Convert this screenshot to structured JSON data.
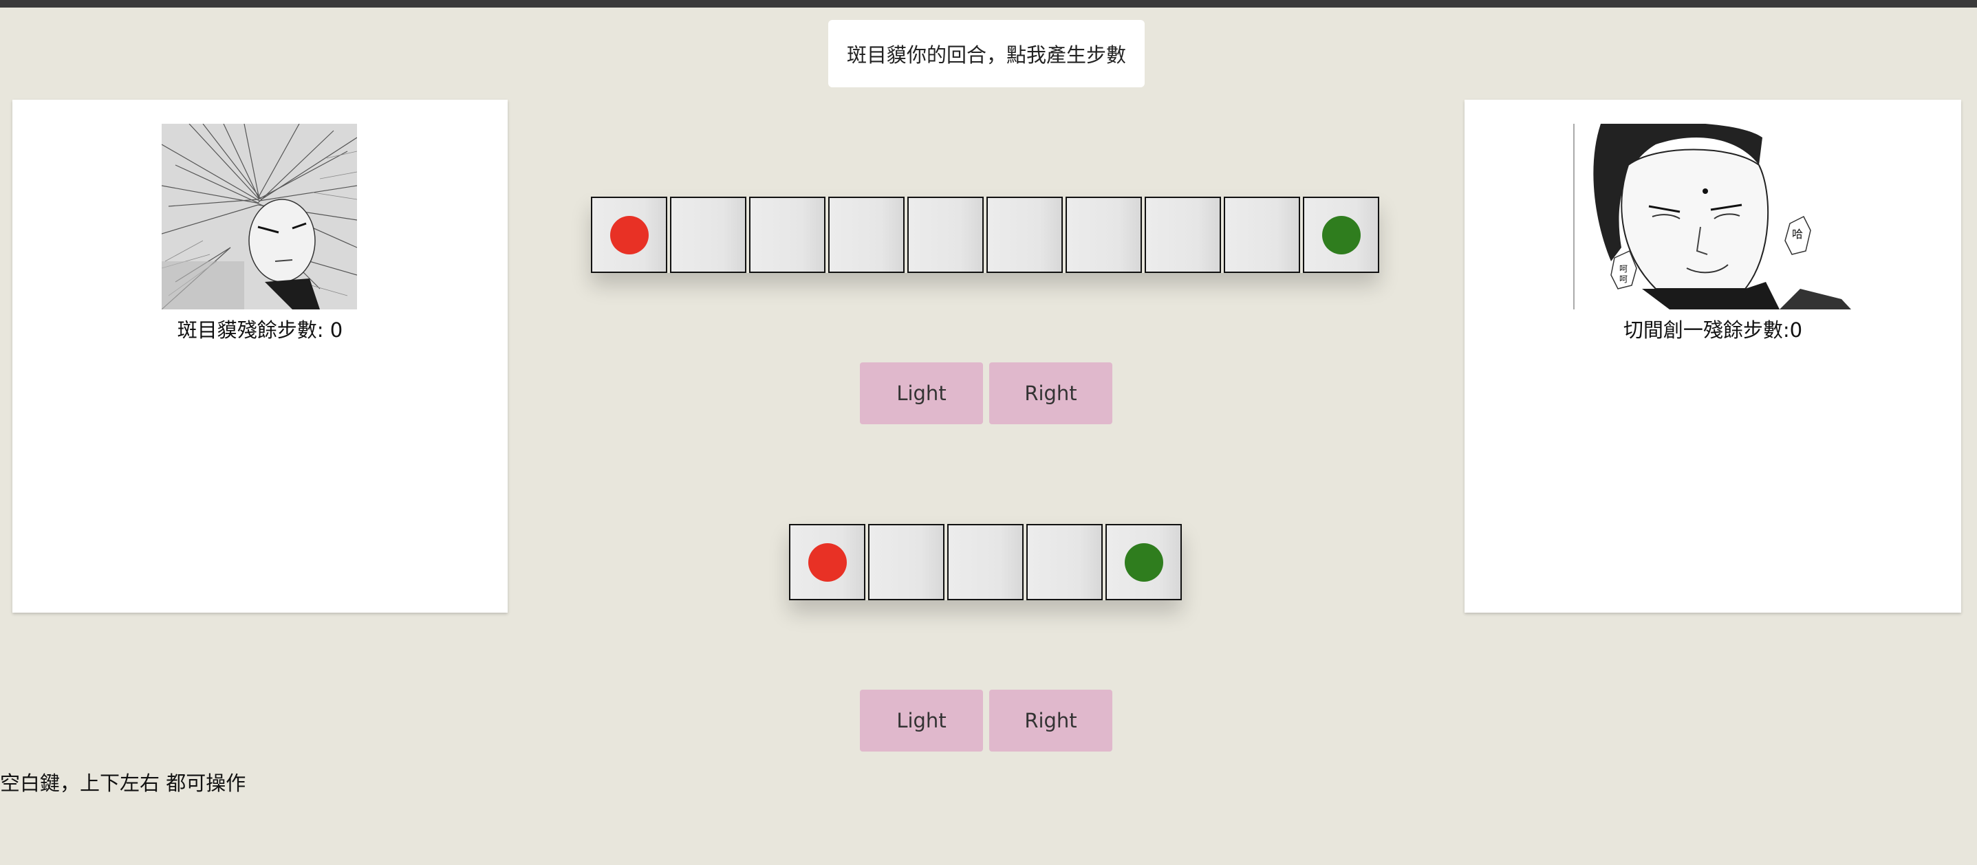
{
  "turn_button": {
    "label": "斑目貘你的回合，點我產生步數"
  },
  "players": {
    "left": {
      "steps_label": "斑目貘殘餘步數: 0"
    },
    "right": {
      "steps_label": "切間創一殘餘步數:0"
    }
  },
  "tracks": [
    {
      "cells": [
        "red",
        "",
        "",
        "",
        "",
        "",
        "",
        "",
        "",
        "green"
      ],
      "buttons": {
        "left_label": "Light",
        "right_label": "Right"
      }
    },
    {
      "cells": [
        "red",
        "",
        "",
        "",
        "green"
      ],
      "buttons": {
        "left_label": "Light",
        "right_label": "Right"
      }
    }
  ],
  "hint": "空白鍵，上下左右 都可操作",
  "colors": {
    "background": "#e8e6dc",
    "red_piece": "#e83125",
    "green_piece": "#2f7d1e",
    "button": "#e0b8cc"
  }
}
